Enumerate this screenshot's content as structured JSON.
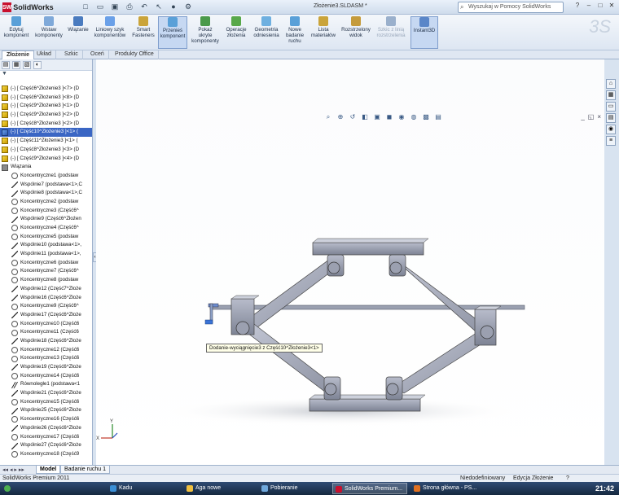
{
  "app": {
    "name": "SolidWorks",
    "doc_title": "Złożenie3.SLDASM *"
  },
  "search": {
    "placeholder": "Wyszukaj w Pomocy SolidWorks"
  },
  "ribbon": {
    "buttons": [
      {
        "label": "Edytuj\nkomponent",
        "icon": "edit-component-icon"
      },
      {
        "label": "Wstaw\nkomponenty",
        "icon": "insert-components-icon"
      },
      {
        "label": "Wiązanie",
        "icon": "mate-icon"
      },
      {
        "label": "Liniowy szyk\nkomponentów",
        "icon": "linear-pattern-icon"
      },
      {
        "label": "Smart\nFasteners",
        "icon": "smart-fasteners-icon"
      },
      {
        "label": "Przenieś\nkomponent",
        "icon": "move-component-icon",
        "active": true
      },
      {
        "label": "Pokaż\nukryte\nkomponenty",
        "icon": "show-hidden-icon"
      },
      {
        "label": "Operacje\nzłożenia",
        "icon": "assembly-features-icon"
      },
      {
        "label": "Geometria\nodniesienia",
        "icon": "reference-geometry-icon"
      },
      {
        "label": "Nowe\nbadanie\nruchu",
        "icon": "new-motion-study-icon"
      },
      {
        "label": "Lista\nmateriałów",
        "icon": "bom-icon"
      },
      {
        "label": "Rozstrzelony\nwidok",
        "icon": "exploded-view-icon"
      },
      {
        "label": "Szkic z linią\nrozstrzelenia",
        "icon": "explode-line-sketch-icon",
        "disabled": true
      },
      {
        "label": "Instant3D",
        "icon": "instant3d-icon",
        "active": true
      }
    ]
  },
  "tabs": [
    "Złożenie",
    "Układ",
    "Szkic",
    "Oceń",
    "Produkty Office"
  ],
  "tree": {
    "items": [
      {
        "label": "(-) [ Część6^Złożenie3 ]<7> (D",
        "type": "part"
      },
      {
        "label": "(-) [ Część6^Złożenie3 ]<8> (D",
        "type": "part"
      },
      {
        "label": "(-) [ Część9^Złożenie3 ]<1> (D",
        "type": "part"
      },
      {
        "label": "(-) [ Część9^Złożenie3 ]<2> (D",
        "type": "part"
      },
      {
        "label": "(-) [ Część8^Złożenie3 ]<2> (D",
        "type": "part"
      },
      {
        "label": "(-) [ Część10^Złożenie3 ]<1> (",
        "type": "part-selected"
      },
      {
        "label": "(-) [ Część11^Złożenie3 ]<1> (",
        "type": "part"
      },
      {
        "label": "(-) [ Część8^Złożenie3 ]<3> (D",
        "type": "part"
      },
      {
        "label": "(-) [ Część9^Złożenie3 ]<4> (D",
        "type": "part"
      },
      {
        "label": "Wiązania",
        "type": "folder"
      },
      {
        "label": "Koncentryczne1 (podstaw",
        "type": "coin"
      },
      {
        "label": "Wspólnie7 (podstawa<1>,C",
        "type": "line"
      },
      {
        "label": "Wspólnie8 (podstawa<1>,C",
        "type": "line"
      },
      {
        "label": "Koncentryczne2 (podstaw",
        "type": "coin"
      },
      {
        "label": "Koncentryczne3 (Część6^",
        "type": "coin"
      },
      {
        "label": "Wspólnie9 (Część6^Złożen",
        "type": "line"
      },
      {
        "label": "Koncentryczne4 (Część6^",
        "type": "coin"
      },
      {
        "label": "Koncentryczne5 (podstaw",
        "type": "coin"
      },
      {
        "label": "Wspólnie10 (podstawa<1>,",
        "type": "line"
      },
      {
        "label": "Wspólnie11 (podstawa<1>,",
        "type": "line"
      },
      {
        "label": "Koncentryczne6 (podstaw",
        "type": "coin"
      },
      {
        "label": "Koncentryczne7 (Część6^",
        "type": "coin"
      },
      {
        "label": "Koncentryczne8 (podstaw",
        "type": "coin"
      },
      {
        "label": "Wspólnie12 (Część7^Złoże",
        "type": "line"
      },
      {
        "label": "Wspólnie16 (Część6^Złoże",
        "type": "line"
      },
      {
        "label": "Koncentryczne9 (Część6^",
        "type": "coin"
      },
      {
        "label": "Wspólnie17 (Część6^Złoże",
        "type": "line"
      },
      {
        "label": "Koncentryczne10 (Część6",
        "type": "coin"
      },
      {
        "label": "Koncentryczne11 (Część6",
        "type": "coin"
      },
      {
        "label": "Wspólnie18 (Część6^Złoże",
        "type": "line"
      },
      {
        "label": "Koncentryczne12 (Część6",
        "type": "coin"
      },
      {
        "label": "Koncentryczne13 (Część6",
        "type": "coin"
      },
      {
        "label": "Wspólnie19 (Część6^Złoże",
        "type": "line"
      },
      {
        "label": "Koncentryczne14 (Część6",
        "type": "coin"
      },
      {
        "label": "Równoległe1 (podstawa<1",
        "type": "par"
      },
      {
        "label": "Wspólnie21 (Część6^Złoże",
        "type": "line"
      },
      {
        "label": "Koncentryczne15 (Część6",
        "type": "coin"
      },
      {
        "label": "Wspólnie25 (Część6^Złoże",
        "type": "line"
      },
      {
        "label": "Koncentryczne16 (Część6",
        "type": "coin"
      },
      {
        "label": "Wspólnie26 (Część6^Złoże",
        "type": "line"
      },
      {
        "label": "Koncentryczne17 (Część6",
        "type": "coin"
      },
      {
        "label": "Wspólnie27 (Część6^Złoże",
        "type": "line"
      },
      {
        "label": "Koncentryczne18 (Część9",
        "type": "coin"
      }
    ]
  },
  "viewport": {
    "tooltip": "Dodanie-wyciągnięcie3 z Część10^Złożenie3<1>"
  },
  "bottom_tabs": [
    "Model",
    "Badanie ruchu 1"
  ],
  "status": {
    "left": "SolidWorks Premium 2011",
    "state": "Niedodefiniowany",
    "mode": "Edycja Złożenie"
  },
  "taskbar": {
    "items": [
      "Kadu",
      "Aga nowe",
      "Pobieranie",
      "SolidWorks Premium...",
      "Strona główna - PS..."
    ],
    "clock": "21:42"
  },
  "colors": {
    "accent": "#3a66c4",
    "part": "#f5d742"
  }
}
